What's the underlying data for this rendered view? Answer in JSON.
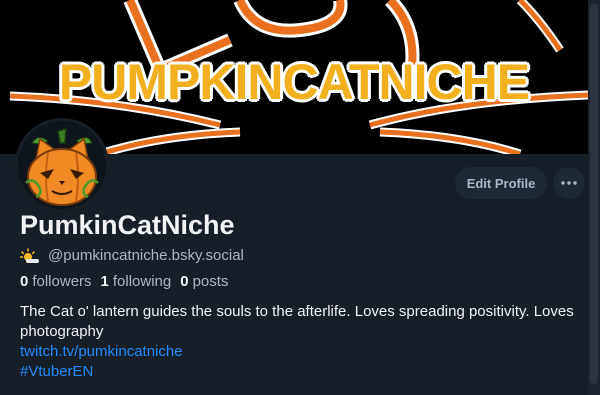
{
  "banner": {
    "text": "PUMPKINCATNICHE"
  },
  "profile": {
    "display_name": "PumkinCatNiche",
    "handle": "@pumkincatniche.bsky.social",
    "handle_icon": "sun-behind-cloud-emoji",
    "edit_label": "Edit Profile",
    "more_icon": "ellipsis-icon"
  },
  "stats": {
    "followers_count": "0",
    "followers_label": "followers",
    "following_count": "1",
    "following_label": "following",
    "posts_count": "0",
    "posts_label": "posts"
  },
  "bio": {
    "line1": "The Cat o' lantern guides the souls to the afterlife. Loves spreading positivity. Loves photography",
    "link1": "twitch.tv/pumkincatniche",
    "link2": "#VtuberEN"
  },
  "colors": {
    "background": "#161e27",
    "link": "#208bfe",
    "button_bg": "#1e2936",
    "banner_orange": "#e8701e"
  }
}
